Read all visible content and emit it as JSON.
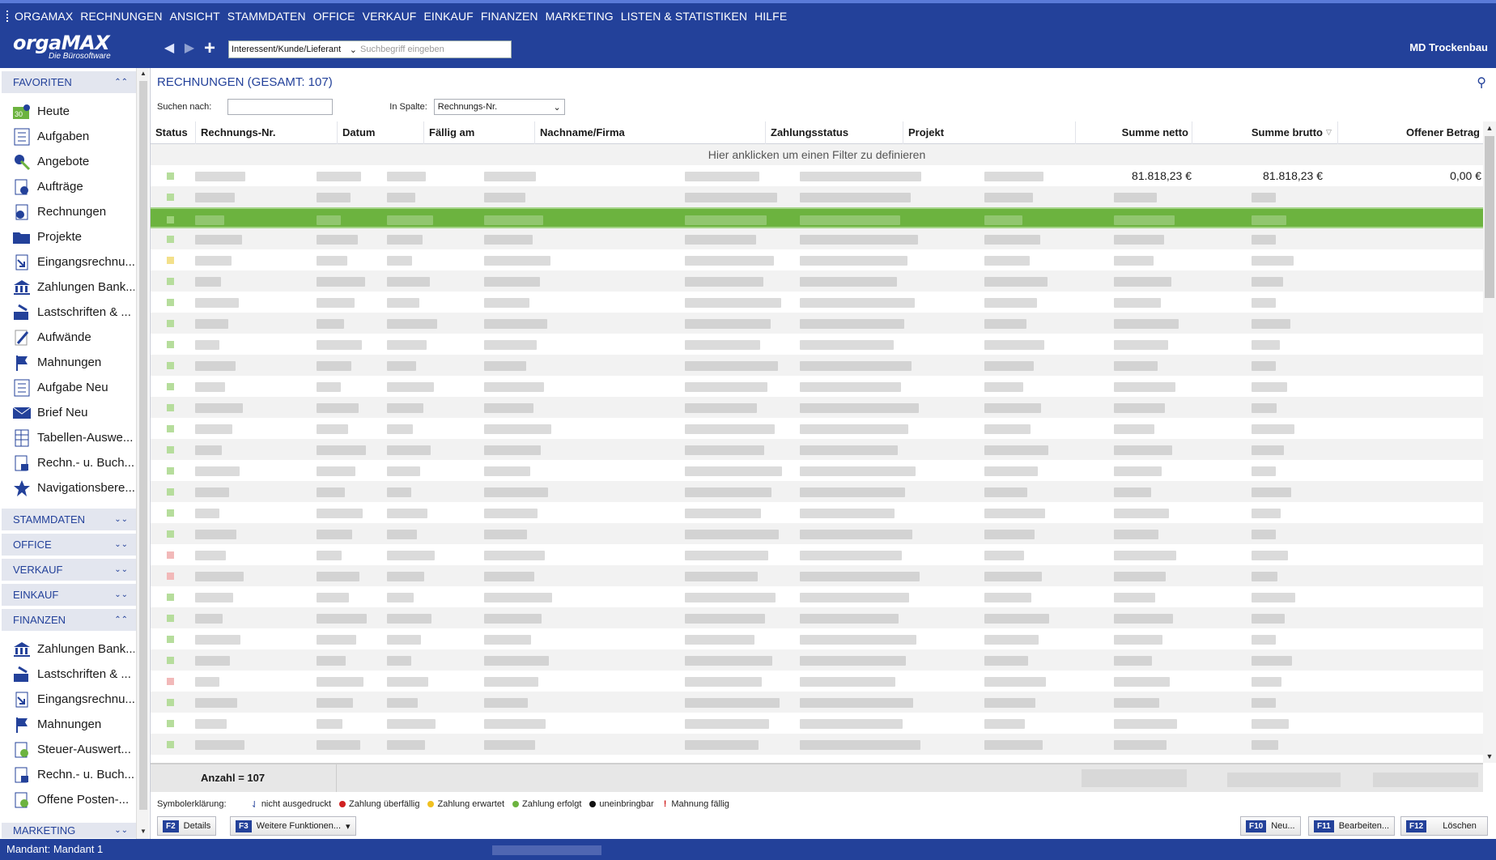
{
  "menu": [
    "ORGAMAX",
    "RECHNUNGEN",
    "ANSICHT",
    "STAMMDATEN",
    "OFFICE",
    "VERKAUF",
    "EINKAUF",
    "FINANZEN",
    "MARKETING",
    "LISTEN & STATISTIKEN",
    "HILFE"
  ],
  "logo": {
    "brand": "orgaMAX",
    "tagline": "Die Bürosoftware"
  },
  "toolbar": {
    "search_scope": "Interessent/Kunde/Lieferant",
    "search_placeholder": "Suchbegriff eingeben",
    "company": "MD Trockenbau"
  },
  "sidebar": {
    "favoriten": {
      "label": "FAVORITEN",
      "items": [
        "Heute",
        "Aufgaben",
        "Angebote",
        "Aufträge",
        "Rechnungen",
        "Projekte",
        "Eingangsrechnu...",
        "Zahlungen Bank...",
        "Lastschriften & ...",
        "Aufwände",
        "Mahnungen",
        "Aufgabe Neu",
        "Brief Neu",
        "Tabellen-Auswe...",
        "Rechn.- u. Buch...",
        "Navigationsbere..."
      ]
    },
    "collapsed": [
      "STAMMDATEN",
      "OFFICE",
      "VERKAUF",
      "EINKAUF"
    ],
    "finanzen": {
      "label": "FINANZEN",
      "items": [
        "Zahlungen Bank...",
        "Lastschriften & ...",
        "Eingangsrechnu...",
        "Mahnungen",
        "Steuer-Auswert...",
        "Rechn.- u. Buch...",
        "Offene Posten-..."
      ]
    },
    "marketing": "MARKETING"
  },
  "main": {
    "title": "RECHNUNGEN (GESAMT: 107)",
    "search_label": "Suchen nach:",
    "column_label": "In Spalte:",
    "column_value": "Rechnungs-Nr.",
    "filter_hint": "Hier anklicken um einen Filter zu definieren",
    "columns": [
      "Status",
      "Rechnungs-Nr.",
      "Datum",
      "Fällig am",
      "Nachname/Firma",
      "Zahlungsstatus",
      "Projekt",
      "Summe netto",
      "Summe brutto",
      "Offener Betrag"
    ],
    "first_row": {
      "netto": "81.818,23 €",
      "brutto": "81.818,23 €",
      "offen": "0,00 €"
    },
    "count": "Anzahl = 107"
  },
  "legend": {
    "label": "Symbolerklärung:",
    "items": [
      {
        "text": "nicht ausgedruckt",
        "color": "#23419a"
      },
      {
        "text": "Zahlung überfällig",
        "color": "#d02020"
      },
      {
        "text": "Zahlung erwartet",
        "color": "#f0c020"
      },
      {
        "text": "Zahlung erfolgt",
        "color": "#6cb33f"
      },
      {
        "text": "uneinbringbar",
        "color": "#111111"
      },
      {
        "text": "Mahnung fällig",
        "color": "#d02020"
      }
    ]
  },
  "buttons": {
    "details_key": "F2",
    "details": "Details",
    "more_key": "F3",
    "more": "Weitere Funktionen...",
    "new_key": "F10",
    "new": "Neu...",
    "edit_key": "F11",
    "edit": "Bearbeiten...",
    "delete_key": "F12",
    "delete": "Löschen"
  },
  "statusbar": {
    "mandant": "Mandant: Mandant 1"
  },
  "colors": {
    "brand": "#23419a",
    "selected_row": "#6cb33f"
  }
}
